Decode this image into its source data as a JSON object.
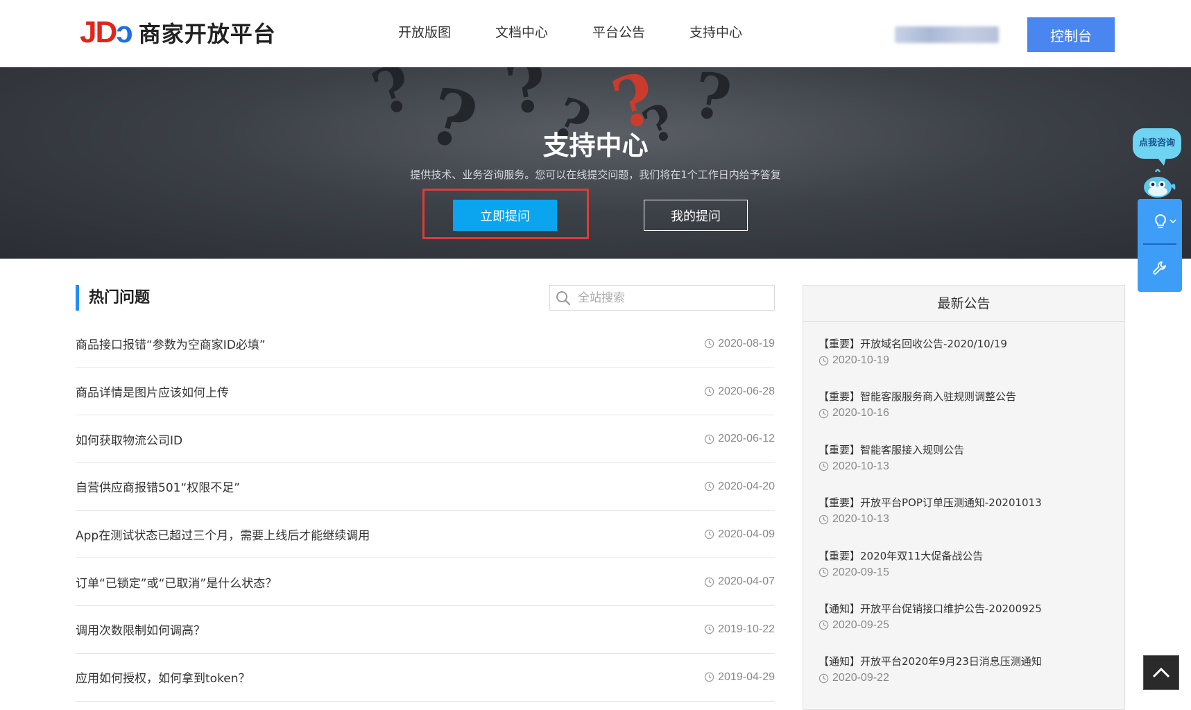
{
  "header": {
    "logo_mark": "JD",
    "logo_text": "商家开放平台",
    "nav": [
      "开放版图",
      "文档中心",
      "平台公告",
      "支持中心"
    ],
    "console_label": "控制台"
  },
  "banner": {
    "title": "支持中心",
    "subtitle": "提供技术、业务咨询服务。您可以在线提交问题，我们将在1个工作日内给予答复",
    "ask_label": "立即提问",
    "my_label": "我的提问"
  },
  "hot": {
    "title": "热门问题",
    "search_placeholder": "全站搜索",
    "questions": [
      {
        "title": "商品接口报错“参数为空商家ID必填”",
        "date": "2020-08-19"
      },
      {
        "title": "商品详情是图片应该如何上传",
        "date": "2020-06-28"
      },
      {
        "title": "如何获取物流公司ID",
        "date": "2020-06-12"
      },
      {
        "title": "自营供应商报错501“权限不足”",
        "date": "2020-04-20"
      },
      {
        "title": "App在测试状态已超过三个月，需要上线后才能继续调用",
        "date": "2020-04-09"
      },
      {
        "title": "订单“已锁定”或“已取消”是什么状态？",
        "date": "2020-04-07"
      },
      {
        "title": "调用次数限制如何调高？",
        "date": "2019-10-22"
      },
      {
        "title": "应用如何授权，如何拿到token？",
        "date": "2019-04-29"
      }
    ]
  },
  "notice": {
    "title": "最新公告",
    "items": [
      {
        "title": "【重要】开放域名回收公告-2020/10/19",
        "date": "2020-10-19"
      },
      {
        "title": "【重要】智能客服服务商入驻规则调整公告",
        "date": "2020-10-16"
      },
      {
        "title": "【重要】智能客服接入规则公告",
        "date": "2020-10-13"
      },
      {
        "title": "【重要】开放平台POP订单压测通知-20201013",
        "date": "2020-10-13"
      },
      {
        "title": "【重要】2020年双11大促备战公告",
        "date": "2020-09-15"
      },
      {
        "title": "【通知】开放平台促销接口维护公告-20200925",
        "date": "2020-09-25"
      },
      {
        "title": "【通知】开放平台2020年9月23日消息压测通知",
        "date": "2020-09-22"
      }
    ]
  },
  "floating": {
    "consult_label": "点我咨询"
  },
  "colors": {
    "brand_blue": "#4a86f0",
    "button_blue": "#0aa5ee",
    "highlight_red": "#e53935",
    "accent_bar": "#1f8ff5"
  }
}
